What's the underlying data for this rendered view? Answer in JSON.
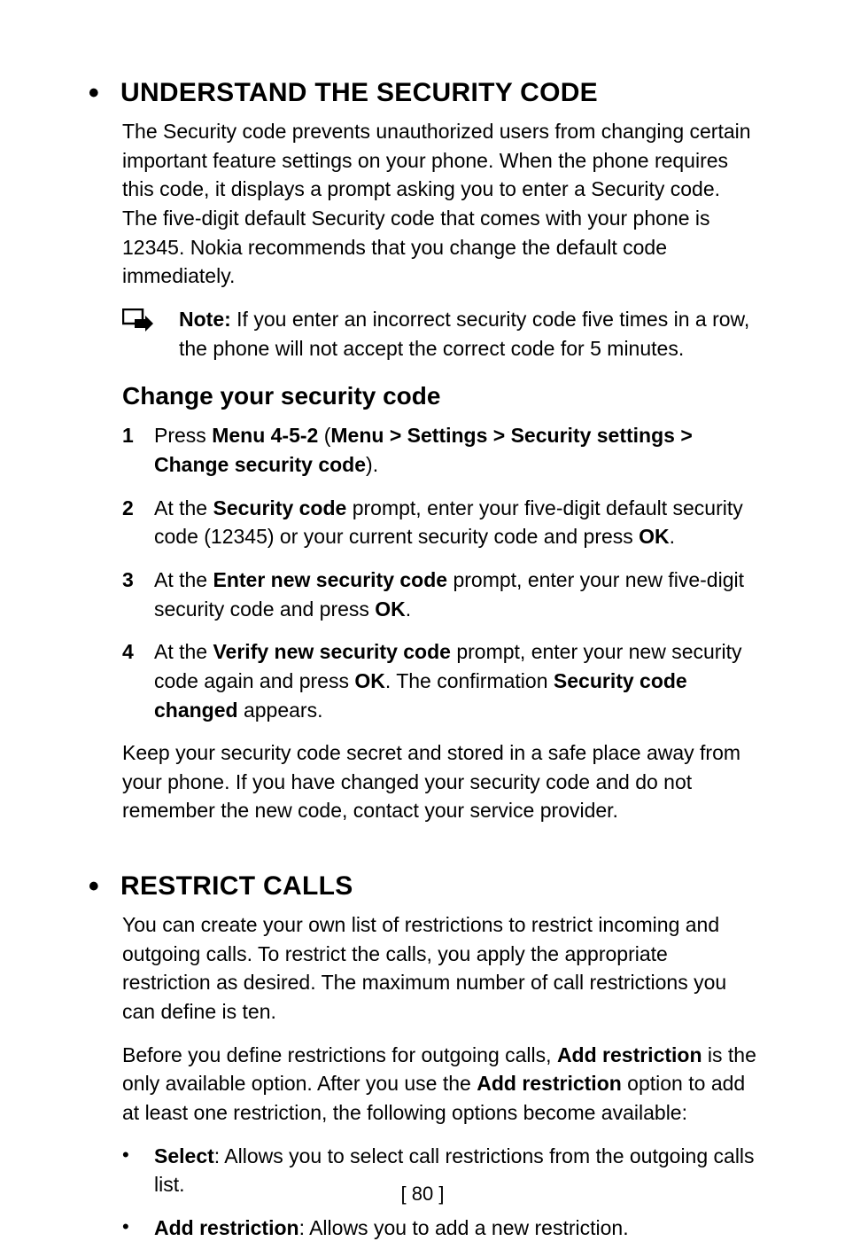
{
  "section1": {
    "title": "UNDERSTAND THE SECURITY CODE",
    "intro": "The Security code prevents unauthorized users from changing certain important feature settings on your phone. When the phone requires this code, it displays a prompt asking you to enter a Security code. The five-digit default Security code that comes with your phone is 12345. Nokia recommends that you change the default code immediately.",
    "note_label": "Note:",
    "note_text": " If you enter an incorrect security code five times in a row, the phone will not accept the correct code for 5 minutes.",
    "sub_title": "Change your security code",
    "steps": {
      "s1_pre": "Press ",
      "s1_b1": "Menu 4-5-2",
      "s1_mid1": " (",
      "s1_b2": "Menu > Settings > Security settings > Change security code",
      "s1_post": ").",
      "s2_pre": "At the ",
      "s2_b1": "Security code",
      "s2_mid": " prompt, enter your five-digit default security code (12345) or your current security code and press ",
      "s2_b2": "OK",
      "s2_post": ".",
      "s3_pre": "At the ",
      "s3_b1": "Enter new security code",
      "s3_mid": " prompt, enter your new five-digit security code and press ",
      "s3_b2": "OK",
      "s3_post": ".",
      "s4_pre": "At the ",
      "s4_b1": "Verify new security code",
      "s4_mid": " prompt, enter your new security code again and press ",
      "s4_b2": "OK",
      "s4_mid2": ". The confirmation ",
      "s4_b3": "Security code changed",
      "s4_post": " appears."
    },
    "after_steps": "Keep your security code secret and stored in a safe place away from your phone. If you have changed your security code and do not remember the new code, contact your service provider."
  },
  "section2": {
    "title": "RESTRICT CALLS",
    "p1": "You can create your own list of restrictions to restrict incoming and outgoing calls. To restrict the calls, you apply the appropriate restriction as desired. The maximum number of call restrictions you can define is ten.",
    "p2_pre": "Before you define restrictions for outgoing calls, ",
    "p2_b1": "Add restriction",
    "p2_mid": " is the only available option. After you use the ",
    "p2_b2": "Add restriction",
    "p2_post": " option to add at least one restriction, the following options become available:",
    "bullets": {
      "b1_b": "Select",
      "b1_rest": ": Allows you to select call restrictions from the outgoing calls list.",
      "b2_b": "Add restriction",
      "b2_rest": ": Allows you to add a new restriction."
    }
  },
  "page_number": "[ 80 ]",
  "nums": {
    "n1": "1",
    "n2": "2",
    "n3": "3",
    "n4": "4"
  },
  "bullet": "•"
}
